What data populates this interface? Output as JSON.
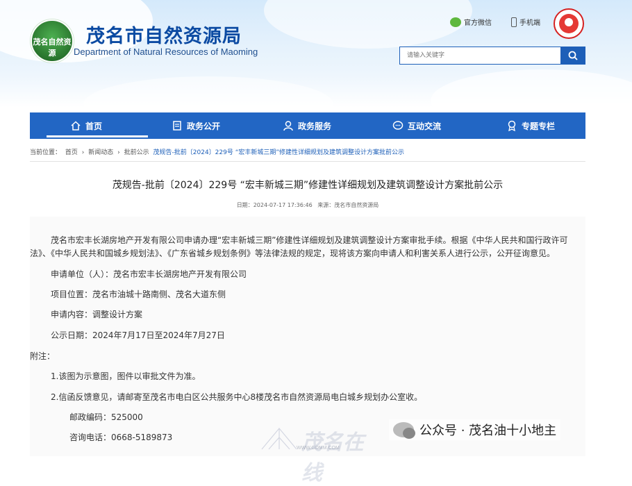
{
  "site": {
    "logo_text": "茂名自然资源",
    "title": "茂名市自然资源局",
    "subtitle": "Department of Natural Resources of Maoming",
    "top_links": [
      "官方微信",
      "手机端"
    ],
    "search_placeholder": "请输入关键字"
  },
  "nav": {
    "items": [
      "首页",
      "政务公开",
      "政务服务",
      "互动交流",
      "专题专栏"
    ]
  },
  "breadcrumb": {
    "label": "当前位置：",
    "items": [
      "首页",
      "新闻动态",
      "批前公示"
    ],
    "current": "茂规告-批前〔2024〕229号 “宏丰新城三期”修建性详细规划及建筑调整设计方案批前公示",
    "separator": "›"
  },
  "article": {
    "title": "茂规告-批前〔2024〕229号 “宏丰新城三期”修建性详细规划及建筑调整设计方案批前公示",
    "date_label": "日期：",
    "date": "2024-07-17 17:36:46",
    "source_label": "来源：",
    "source": "茂名市自然资源局",
    "p1_line1": "茂名市宏丰长湖房地产开发有限公司申请办理“宏丰新城三期”修建性详细规划及建筑调整设计方案审批手续。根据《中华人民共和国行政许可",
    "p1_line2": "法》、《中华人民共和国城乡规划法》、《广东省城乡规划条例》等法律法规的规定，现将该方案向申请人和利害关系人进行公示，公开征询意见。",
    "applicant": "申请单位（人）：茂名市宏丰长湖房地产开发有限公司",
    "location": "项目位置：茂名市油城十路南侧、茂名大道东侧",
    "content": "申请内容：调整设计方案",
    "period": "公示日期：2024年7月17日至2024年7月27日",
    "note_label": "附注：",
    "note1": "1.该图为示意图，图件以审批文件为准。",
    "note2": "2.信函反馈意见，请邮寄至茂名市电白区公共服务中心8楼茂名市自然资源局电白城乡规划办公室收。",
    "postcode": "邮政编码：525000",
    "phone": "咨询电话：0668-5189873"
  },
  "watermark": {
    "account": "公众号 · 茂名油十小地主",
    "site_mark": "茂名在线",
    "site_url": "WWW.GDMM.COM"
  },
  "colors": {
    "brand_blue": "#2266c4",
    "title_blue": "#0b4aa2",
    "link_blue": "#1d5fb8"
  }
}
